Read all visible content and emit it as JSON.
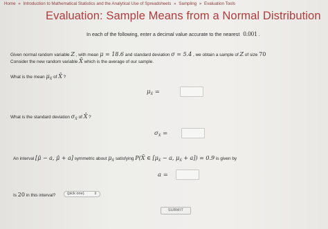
{
  "breadcrumb": {
    "items": [
      "Home",
      "Introduction to Mathematical Statistics and the Analytical Use of Spreadsheets",
      "Sampling",
      "Evaluation Tools"
    ],
    "separator": "»"
  },
  "title": "Evaluation: Sample Means from a Normal Distribution",
  "instructions": {
    "text": "In each of the following, enter a decimal value accurate to the nearest",
    "precision": "0.001",
    "period": "."
  },
  "problem": {
    "line1_a": "Given normal random variable",
    "var_z": "Z",
    "line1_b": ", with mean",
    "mu_eq": "μ = 18.6",
    "line1_c": "and standard deviation",
    "sigma_eq": "σ = 5.4",
    "line1_d": ", we obtain a sample of",
    "line1_e": "of size",
    "n": "70",
    "line2_a": "Consider the new random variable",
    "xbar": "X̄",
    "line2_b": "which is the average of our sample."
  },
  "q1": {
    "text_a": "What is the mean",
    "text_b": "of",
    "text_c": "?",
    "mu_sym": "μ",
    "sub": "X̄",
    "answer_label": "μ",
    "answer_value": ""
  },
  "q2": {
    "text_a": "What is the standard deviation",
    "text_b": "of",
    "text_c": "?",
    "sigma_sym": "σ",
    "sub": "X̄",
    "answer_label": "σ",
    "answer_value": ""
  },
  "q3": {
    "text_a": "An interval",
    "interval": "[μ̂ − a, μ̂ + a]",
    "text_b": "symmetric about",
    "text_c": "satisfying",
    "prob_expr": "P(X̄ ∈ [μ",
    "prob_mid": "− a, μ",
    "prob_end": "+ a]) = 0.9",
    "text_d": "is given by",
    "answer_label": "a =",
    "answer_value": ""
  },
  "q4": {
    "text_a": "Is",
    "value": "20",
    "text_b": "in this interval?",
    "select_value": "(pick one)"
  },
  "submit_label": "SUBMIT"
}
